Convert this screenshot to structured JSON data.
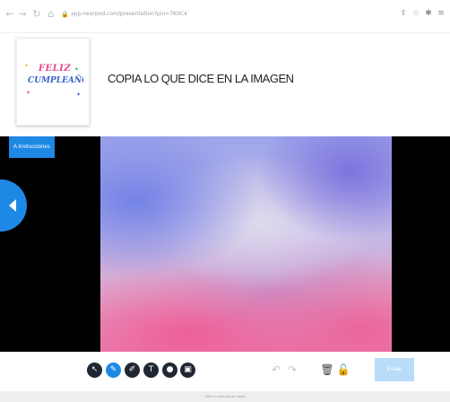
{
  "browser": {
    "url": "app.nearpod.com/presentation?pin=7K9C4",
    "icons": [
      "back-icon",
      "forward-icon",
      "reload-icon",
      "home-icon",
      "lock-icon",
      "share-icon",
      "star-icon",
      "extension-icon",
      "menu-icon"
    ],
    "glyphs": {
      "back": "←",
      "forward": "→",
      "reload": "↻",
      "home": "⌂",
      "lock": "🔒",
      "share": "⇪",
      "star": "☆",
      "extension": "✱",
      "menu": "≡"
    }
  },
  "header": {
    "thumbnail": {
      "line1": "FELIZ",
      "line2": "CUMPLEAÑOS"
    },
    "title": "COPIA LO QUE DICE EN LA IMAGEN"
  },
  "stage": {
    "instructions_label": "A Instrucciones",
    "colors": {
      "letterbox": "#000000",
      "accent": "#1e88e5"
    }
  },
  "toolbar": {
    "tools": [
      {
        "name": "select-tool-icon",
        "glyph": "↖",
        "active": false
      },
      {
        "name": "pen-tool-icon",
        "glyph": "✎",
        "active": true
      },
      {
        "name": "highlighter-tool-icon",
        "glyph": "✐",
        "active": false
      },
      {
        "name": "text-tool-icon",
        "glyph": "T",
        "active": false
      },
      {
        "name": "shape-tool-icon",
        "glyph": "●",
        "active": false
      },
      {
        "name": "image-tool-icon",
        "glyph": "▣",
        "active": false
      }
    ],
    "undo_glyph": "↶",
    "redo_glyph": "↷",
    "trash_glyph": "🗑",
    "lock_glyph": "🔓",
    "save_label": "Enviar",
    "save_color": "#b8dcfa"
  },
  "footer": {
    "text": "Click el carrusel de notas"
  }
}
